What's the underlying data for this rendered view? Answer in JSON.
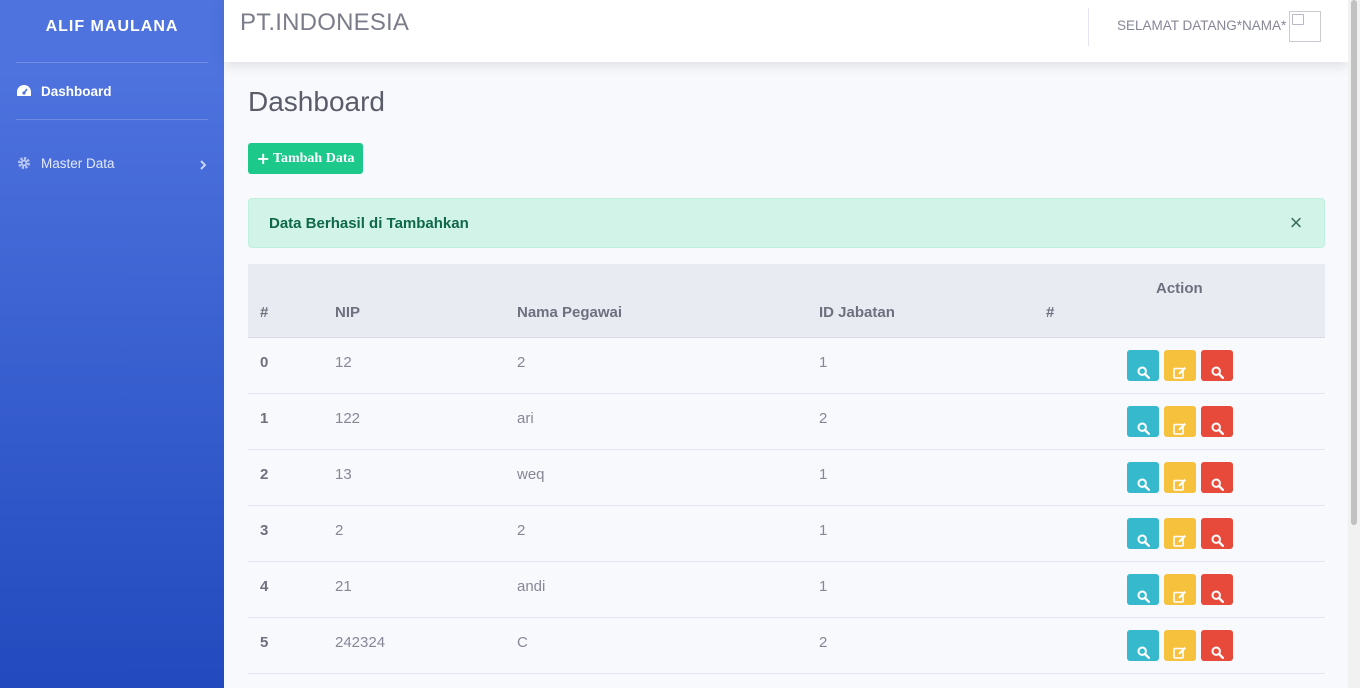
{
  "sidebar": {
    "brand": "ALIF MAULANA",
    "items": [
      {
        "label": "Dashboard",
        "icon": "tachometer-icon",
        "active": true
      },
      {
        "label": "Master Data",
        "icon": "gear-icon",
        "active": false
      }
    ]
  },
  "topbar": {
    "company": "PT.INDONESIA",
    "welcome": "SELAMAT DATANG*NAMA*"
  },
  "main": {
    "title": "Dashboard",
    "add_button": "Tambah Data",
    "alert": "Data Berhasil di Tambahkan",
    "alert_close": "×"
  },
  "table": {
    "headers": [
      "#",
      "NIP",
      "Nama Pegawai",
      "ID Jabatan",
      "#",
      "Action"
    ],
    "rows": [
      {
        "no": "0",
        "nip": "12",
        "nama": "2",
        "jabatan": "1"
      },
      {
        "no": "1",
        "nip": "122",
        "nama": "ari",
        "jabatan": "2"
      },
      {
        "no": "2",
        "nip": "13",
        "nama": "weq",
        "jabatan": "1"
      },
      {
        "no": "3",
        "nip": "2",
        "nama": "2",
        "jabatan": "1"
      },
      {
        "no": "4",
        "nip": "21",
        "nama": "andi",
        "jabatan": "1"
      },
      {
        "no": "5",
        "nip": "242324",
        "nama": "C",
        "jabatan": "2"
      }
    ],
    "action_icons": [
      "search-icon",
      "edit-icon",
      "search-icon"
    ]
  },
  "colors": {
    "primary": "#4e73df",
    "success": "#1cc88a",
    "info": "#36b9cc",
    "warning": "#f6c23e",
    "danger": "#e74a3b"
  }
}
